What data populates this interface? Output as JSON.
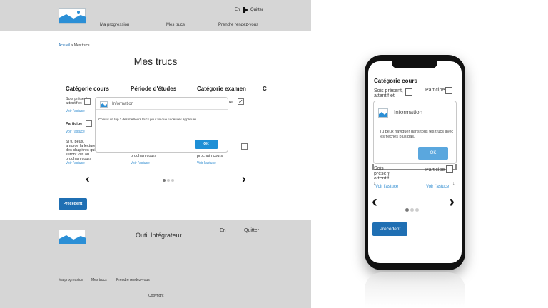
{
  "header": {
    "lang": "En",
    "quit": "Quitter",
    "nav": [
      "Ma progression",
      "Mes trucs",
      "Prendre rendez-vous"
    ]
  },
  "breadcrumb": {
    "home": "Accueil",
    "sep": " > ",
    "current": "Mes trucs"
  },
  "page_title": "Mes trucs",
  "columns": [
    {
      "title": "Catégorie cours",
      "item1": "Sois présent, attentif et concentré",
      "item2": "Participe",
      "item3": "Si tu peux, amorce la lecture des chapitres qui seront vus au prochain cours",
      "link": "Voir l'astuce"
    },
    {
      "title": "Période d'études",
      "item3": "prochain cours",
      "link": "Voir l'astuce"
    },
    {
      "title": "Catégorie examen",
      "item1": "ré",
      "item3": "prochain cours",
      "link": "Voir l'astuce"
    },
    {
      "title": "C"
    }
  ],
  "modal": {
    "title": "Information",
    "text": "Choisis un top 3 des meilleurs trucs pour toi que tu désires appliquer.",
    "ok": "OK"
  },
  "prev_button": "Précédent",
  "footer": {
    "title": "Outil Intégrateur",
    "lang": "En",
    "quit": "Quitter",
    "links": [
      "Ma progression",
      "Mes trucs",
      "Prendre rendez-vous"
    ],
    "copyright": "Copyright"
  },
  "mobile": {
    "title": "Catégorie cours",
    "item1": "Sois présent, attentif et concentré",
    "item2": "Participe",
    "link": "Voir l'astuce",
    "modal": {
      "title": "Information",
      "text": "Tu peux naviguer dans tous tes trucs avec les flèches plus bas.",
      "ok": "OK"
    },
    "prev": "Précédent"
  },
  "colors": {
    "primary": "#1f6fb3",
    "link": "#2e8bd0",
    "header_bg": "#d6d6d6",
    "ok_button": "#1e8fd6"
  },
  "icons": [
    "logo-icon",
    "quit-icon",
    "checkbox-icon",
    "chevron-left-icon",
    "chevron-right-icon",
    "information-icon"
  ]
}
